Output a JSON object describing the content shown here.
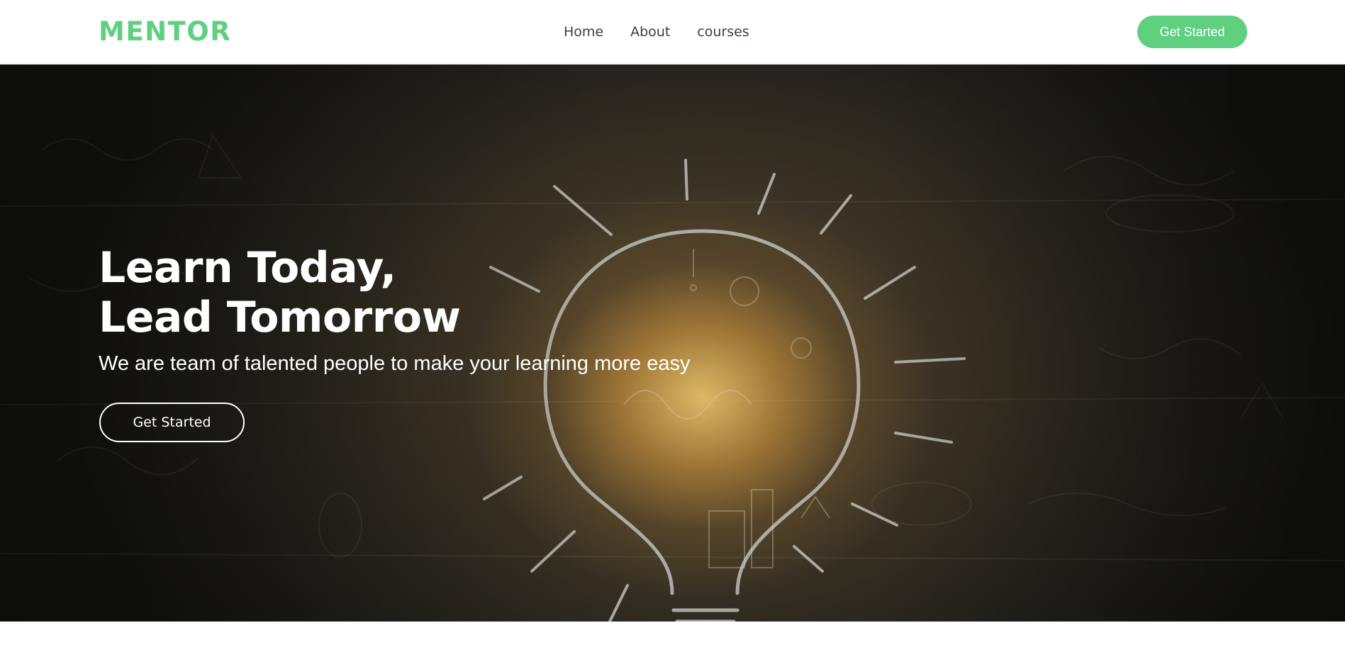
{
  "header": {
    "logo": "MENTOR",
    "nav": [
      {
        "label": "Home"
      },
      {
        "label": "About"
      },
      {
        "label": "courses"
      }
    ],
    "cta_label": "Get Started"
  },
  "hero": {
    "title_line1": "Learn Today,",
    "title_line2": "Lead Tomorrow",
    "subtitle": "We are team of talented people to make your learning more easy",
    "button_label": "Get Started",
    "background_icon": "lightbulb-chalk-drawing"
  },
  "colors": {
    "accent": "#5fcf80",
    "nav_text": "#37423b",
    "hero_text": "#ffffff"
  }
}
